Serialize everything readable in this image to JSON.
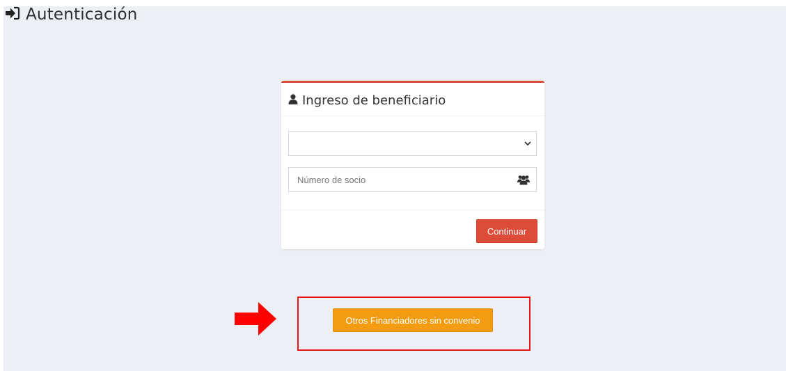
{
  "header": {
    "title": "Autenticación",
    "icon": "sign-in-icon"
  },
  "login_card": {
    "title": "Ingreso de beneficiario",
    "icon": "user-icon",
    "accent_color": "#dd4b39",
    "financiador_select": {
      "selected_value": "",
      "icon": "chevron-down-icon"
    },
    "socio_input": {
      "value": "",
      "placeholder": "Número de socio",
      "icon": "users-icon"
    },
    "continue_button": {
      "label": "Continuar",
      "color": "#dd4b39"
    }
  },
  "otros_button": {
    "label": "Otros Financiadores sin convenio",
    "color": "#f39c12"
  },
  "annotation": {
    "arrow_color": "#ff0000",
    "box_color": "#e8161b"
  }
}
